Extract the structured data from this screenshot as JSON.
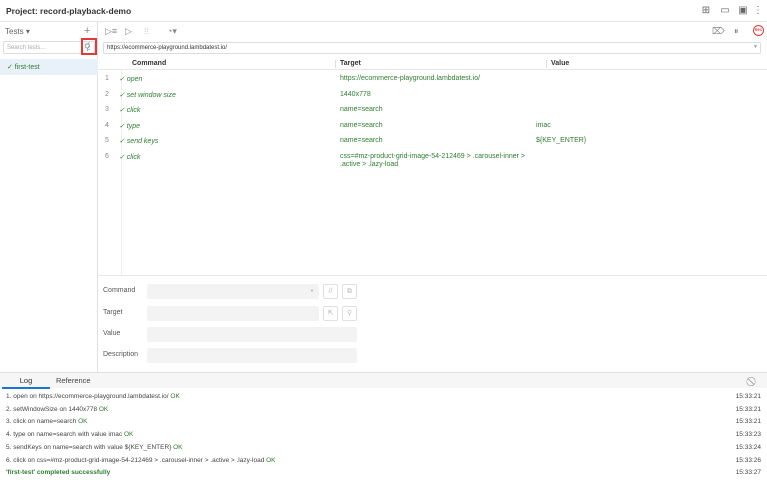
{
  "project": {
    "title": "Project:  record-playback-demo"
  },
  "sidebar": {
    "tests_label": "Tests ▾",
    "add": "+",
    "search_placeholder": "Search tests...",
    "tests": [
      {
        "name": "✓ first-test"
      }
    ]
  },
  "toolbar": {
    "url": "https://ecommerce-playground.lambdatest.io/"
  },
  "table": {
    "headers": [
      "Command",
      "Target",
      "Value"
    ],
    "rows": [
      {
        "n": "1",
        "command": "✓ open",
        "target": "https://ecommerce-playground.lambdatest.io/",
        "value": ""
      },
      {
        "n": "2",
        "command": "✓ set window size",
        "target": "1440x778",
        "value": ""
      },
      {
        "n": "3",
        "command": "✓ click",
        "target": "name=search",
        "value": ""
      },
      {
        "n": "4",
        "command": "✓ type",
        "target": "name=search",
        "value": "imac"
      },
      {
        "n": "5",
        "command": "✓ send keys",
        "target": "name=search",
        "value": "${KEY_ENTER}"
      },
      {
        "n": "6",
        "command": "✓ click",
        "target": "css=#mz-product-grid-image-54-212469 > .carousel-inner > .active > .lazy-load",
        "value": ""
      }
    ]
  },
  "editor": {
    "command_label": "Command",
    "target_label": "Target",
    "value_label": "Value",
    "description_label": "Description"
  },
  "log": {
    "tabs": [
      "Log",
      "Reference"
    ],
    "entries": [
      {
        "text": "1.   open on https://ecommerce-playground.lambdatest.io/ ",
        "status": "OK",
        "time": "15:33:21"
      },
      {
        "text": "2.   setWindowSize on 1440x778 ",
        "status": "OK",
        "time": "15:33:21"
      },
      {
        "text": "3.   click on name=search ",
        "status": "OK",
        "time": "15:33:21"
      },
      {
        "text": "4.   type on name=search with value imac ",
        "status": "OK",
        "time": "15:33:23"
      },
      {
        "text": "5.   sendKeys on name=search with value ${KEY_ENTER} ",
        "status": "OK",
        "time": "15:33:24"
      },
      {
        "text": "6.   click on css=#mz-product-grid-image-54-212469 > .carousel-inner > .active > .lazy-load ",
        "status": "OK",
        "time": "15:33:26"
      }
    ],
    "summary": "'first-test' completed successfully",
    "summary_time": "15:33:27"
  },
  "colors": {
    "success": "#2e7d32",
    "accent": "#1976d2",
    "highlight": "#e53935"
  }
}
